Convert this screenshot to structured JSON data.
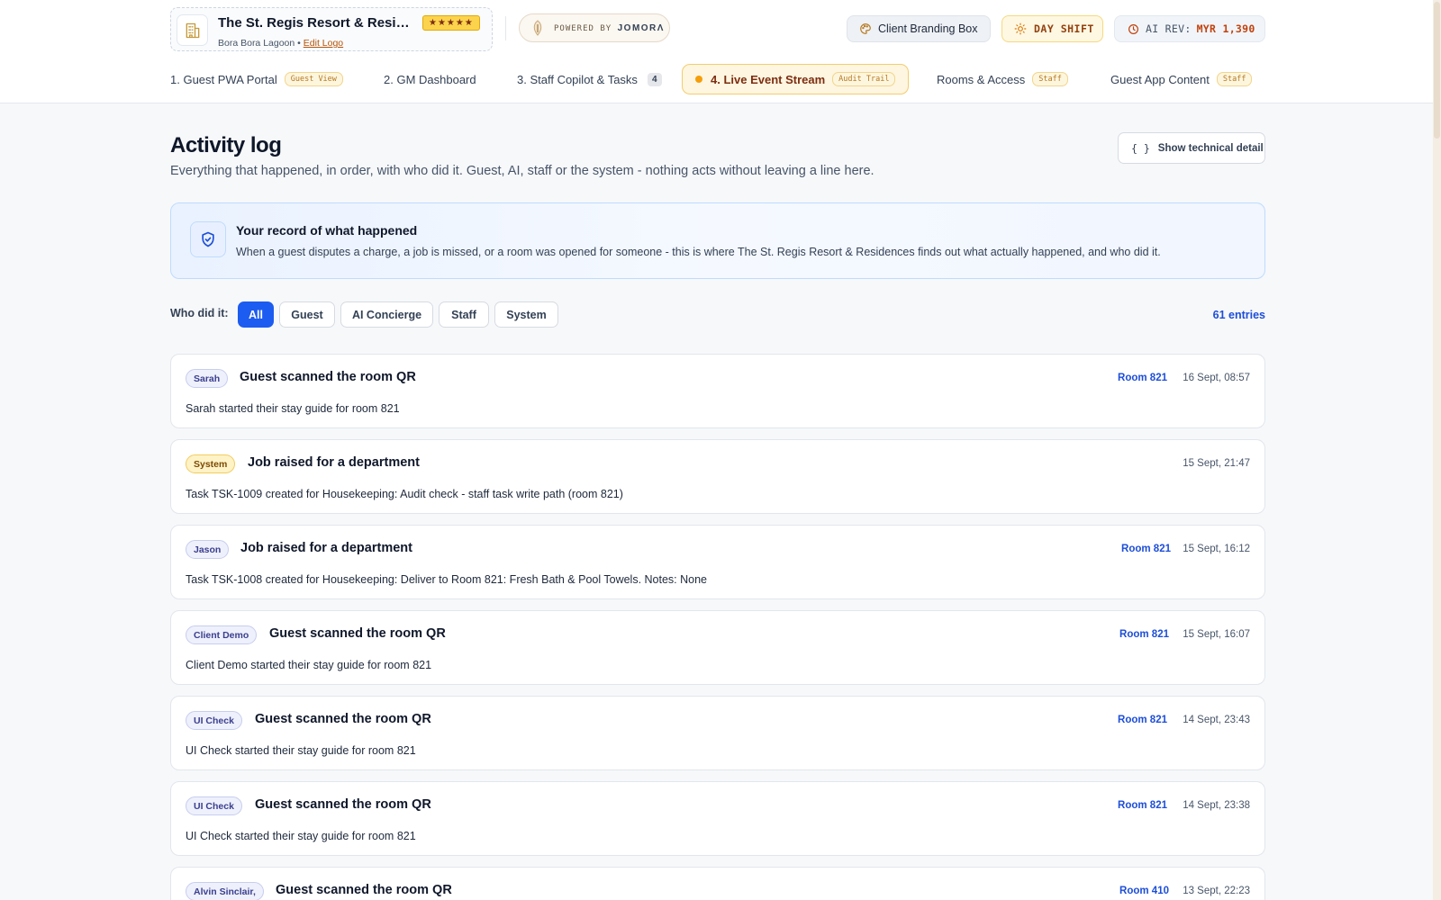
{
  "brand": {
    "name": "The St. Regis Resort & Residen...",
    "stars": "★★★★★",
    "location": "Bora Bora Lagoon",
    "separator": "•",
    "edit_logo": "Edit Logo"
  },
  "powered": {
    "prefix": "POWERED BY",
    "brand": "JOMORΛ"
  },
  "header_pills": {
    "branding_box": "Client Branding Box",
    "shift": "DAY SHIFT",
    "ai_rev_label": "AI REV:",
    "ai_rev_value": "MYR 1,390"
  },
  "tabs": [
    {
      "label": "1. Guest PWA Portal",
      "tag": "Guest View"
    },
    {
      "label": "2. GM Dashboard"
    },
    {
      "label": "3. Staff Copilot & Tasks",
      "count": "4"
    },
    {
      "label": "4. Live Event Stream",
      "tag": "Audit Trail",
      "active": true
    },
    {
      "label": "Rooms & Access",
      "tag": "Staff"
    },
    {
      "label": "Guest App Content",
      "tag": "Staff"
    }
  ],
  "page": {
    "title": "Activity log",
    "subtitle": "Everything that happened, in order, with who did it. Guest, AI, staff or the system - nothing acts without leaving a line here.",
    "tech_button_icon": "{ }",
    "tech_button": "Show technical detail"
  },
  "banner": {
    "icon": "shield-check-icon",
    "title": "Your record of what happened",
    "text": "When a guest disputes a charge, a job is missed, or a room was opened for someone - this is where The St. Regis Resort & Residences finds out what actually happened, and who did it."
  },
  "filter": {
    "label": "Who did it:",
    "options": [
      "All",
      "Guest",
      "AI Concierge",
      "Staff",
      "System"
    ],
    "selected": "All",
    "entries": "61 entries"
  },
  "events": [
    {
      "actor": "Sarah",
      "actor_type": "person",
      "title": "Guest scanned the room QR",
      "room": "Room 821",
      "time": "16 Sept, 08:57",
      "desc": "Sarah started their stay guide for room 821"
    },
    {
      "actor": "System",
      "actor_type": "system",
      "title": "Job raised for a department",
      "room": "",
      "time": "15 Sept, 21:47",
      "desc": "Task TSK-1009 created for Housekeeping: Audit check - staff task write path (room 821)"
    },
    {
      "actor": "Jason",
      "actor_type": "person",
      "title": "Job raised for a department",
      "room": "Room 821",
      "time": "15 Sept, 16:12",
      "desc": "Task TSK-1008 created for Housekeeping: Deliver to Room 821: Fresh Bath & Pool Towels. Notes: None"
    },
    {
      "actor": "Client Demo",
      "actor_type": "person",
      "title": "Guest scanned the room QR",
      "room": "Room 821",
      "time": "15 Sept, 16:07",
      "desc": "Client Demo started their stay guide for room 821"
    },
    {
      "actor": "UI Check",
      "actor_type": "person",
      "title": "Guest scanned the room QR",
      "room": "Room 821",
      "time": "14 Sept, 23:43",
      "desc": "UI Check started their stay guide for room 821"
    },
    {
      "actor": "UI Check",
      "actor_type": "person",
      "title": "Guest scanned the room QR",
      "room": "Room 821",
      "time": "14 Sept, 23:38",
      "desc": "UI Check started their stay guide for room 821"
    },
    {
      "actor": "Alvin Sinclair,",
      "actor_type": "person",
      "title": "Guest scanned the room QR",
      "room": "Room 410",
      "time": "13 Sept, 22:23",
      "desc": ""
    }
  ],
  "colors": {
    "accent_blue": "#1d5cf0",
    "room_link": "#1d4ed8",
    "amber": "#f59e0b",
    "rev_orange": "#c2410c"
  }
}
